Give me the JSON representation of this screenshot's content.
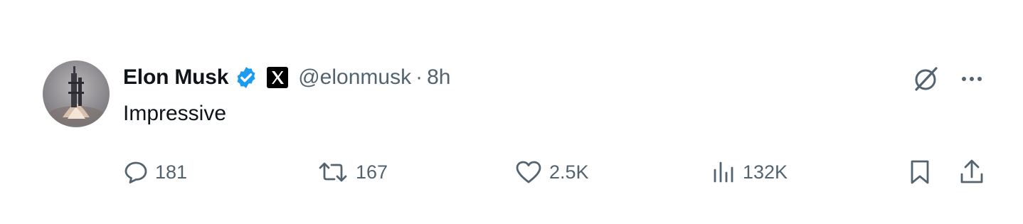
{
  "tweet": {
    "author": {
      "name": "Elon Musk",
      "handle": "@elonmusk",
      "verified": true,
      "avatar_icon": "rocket-launch-avatar",
      "affiliate_badge_icon": "x-logo-icon"
    },
    "separator": "·",
    "time": "8h",
    "text": "Impressive"
  },
  "actions": {
    "reply": {
      "icon": "reply-icon",
      "count": "181"
    },
    "repost": {
      "icon": "repost-icon",
      "count": "167"
    },
    "like": {
      "icon": "heart-icon",
      "count": "2.5K"
    },
    "views": {
      "icon": "views-icon",
      "count": "132K"
    },
    "bookmark": {
      "icon": "bookmark-icon"
    },
    "share": {
      "icon": "share-icon"
    }
  },
  "colors": {
    "text_primary": "#0f1419",
    "text_secondary": "#536471",
    "verified_blue": "#1d9bf0"
  }
}
